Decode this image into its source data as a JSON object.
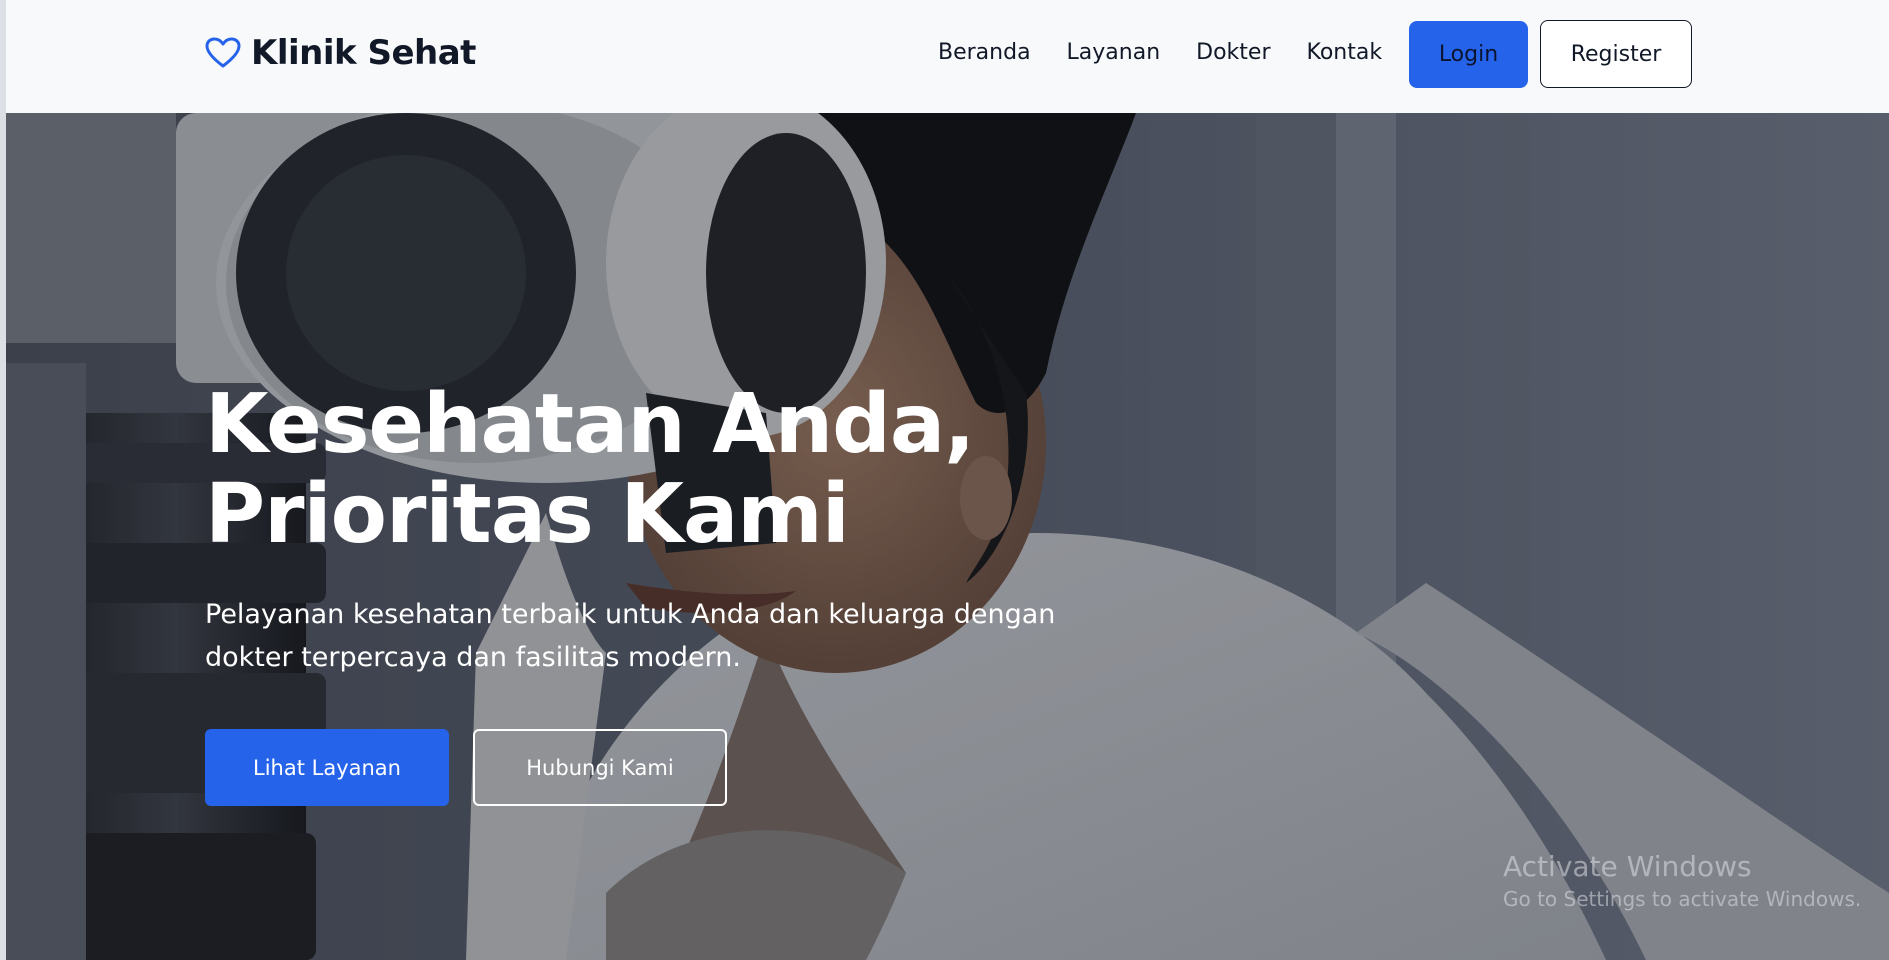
{
  "brand": {
    "name": "Klinik Sehat",
    "icon": "heart-icon",
    "accent_color": "#2563eb"
  },
  "nav": {
    "links": [
      "Beranda",
      "Layanan",
      "Dokter",
      "Kontak"
    ],
    "login_label": "Login",
    "register_label": "Register"
  },
  "hero": {
    "title_line1": "Kesehatan Anda,",
    "title_line2": "Prioritas Kami",
    "subtitle_line1": "Pelayanan kesehatan terbaik untuk Anda dan keluarga dengan",
    "subtitle_line2": "dokter terpercaya dan fasilitas modern.",
    "primary_button": "Lihat Layanan",
    "secondary_button": "Hubungi Kami"
  },
  "watermark": {
    "title": "Activate Windows",
    "subtitle": "Go to Settings to activate Windows."
  }
}
